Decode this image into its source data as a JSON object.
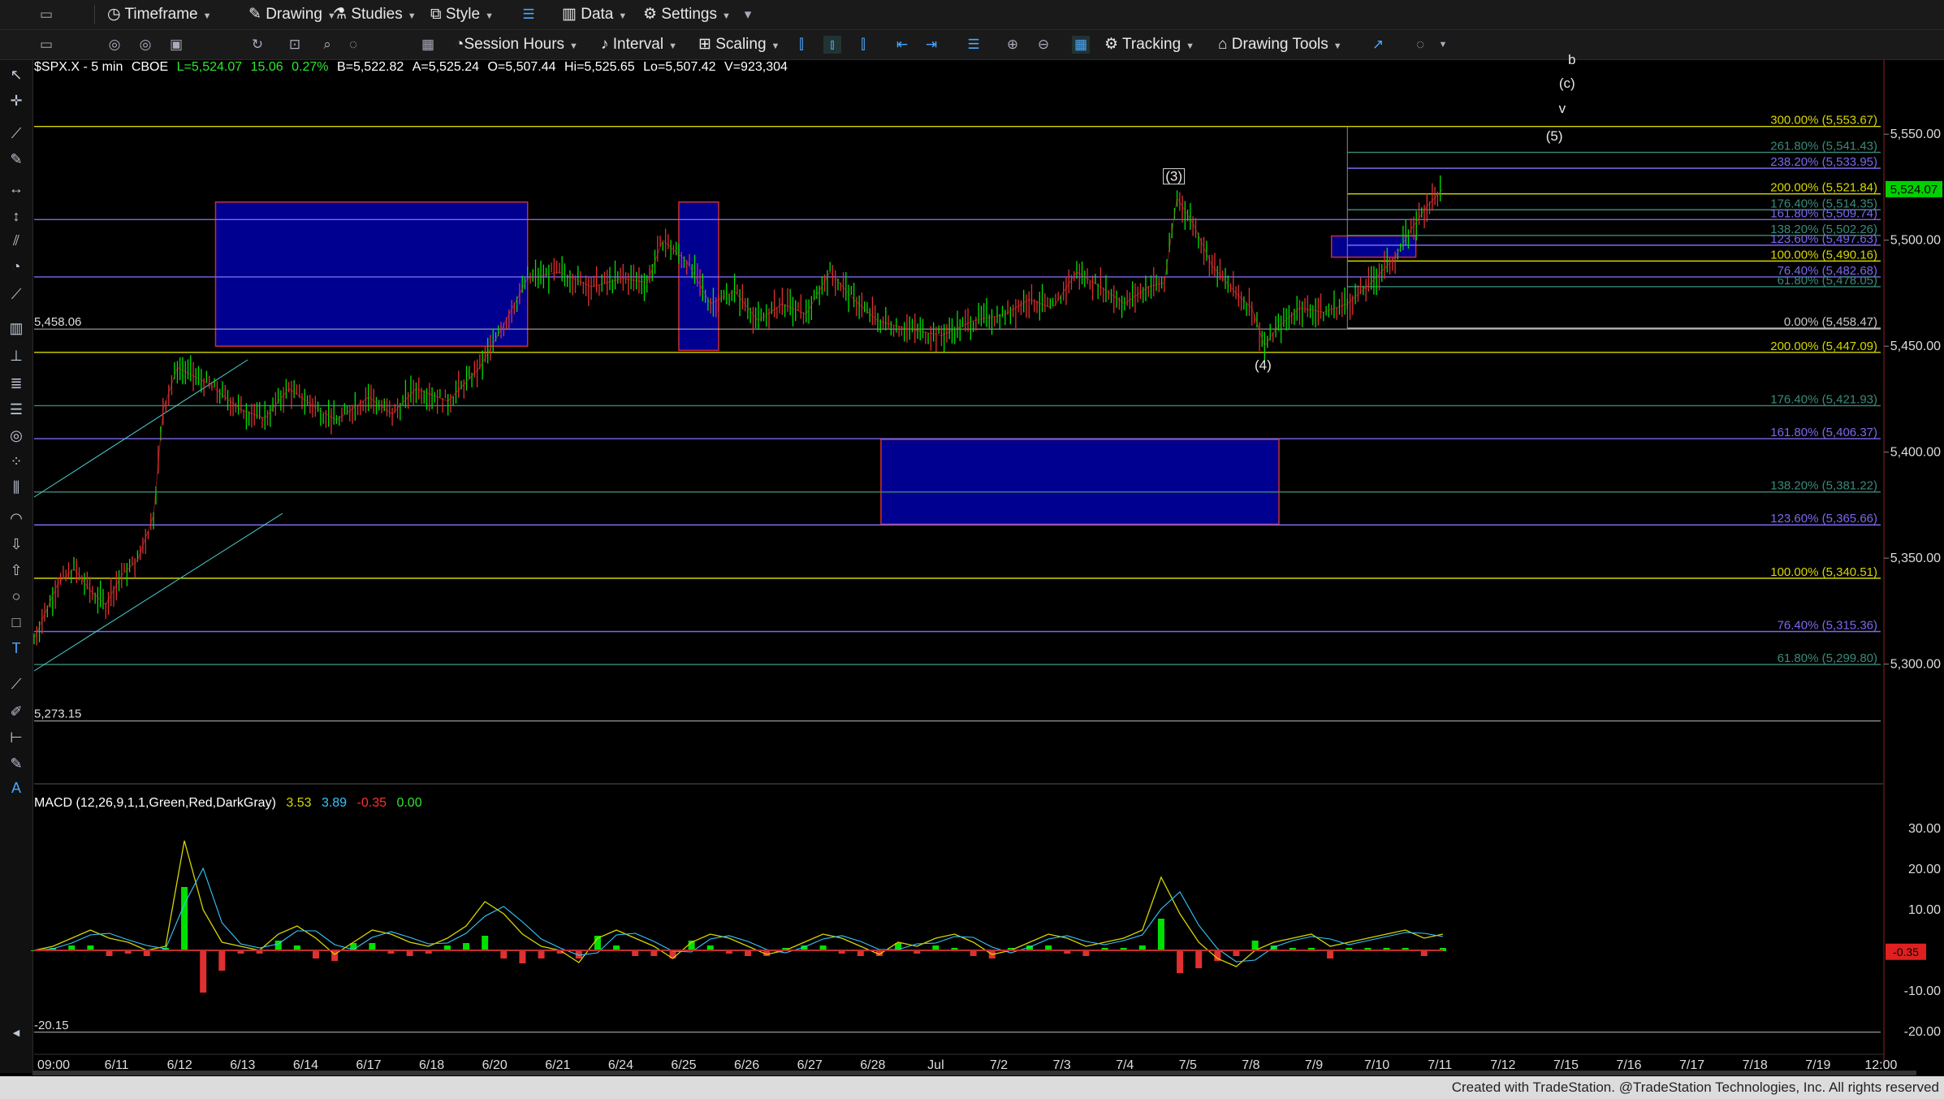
{
  "toolbar_top": {
    "items": [
      {
        "label": "Timeframe",
        "icon": "clock-icon"
      },
      {
        "label": "Drawing",
        "icon": "pencil-icon"
      },
      {
        "label": "Studies",
        "icon": "flask-icon"
      },
      {
        "label": "Style",
        "icon": "style-icon"
      },
      {
        "label": "Data",
        "icon": "bar-chart-icon"
      },
      {
        "label": "Settings",
        "icon": "gear-icon"
      }
    ]
  },
  "toolbar_second": {
    "items": [
      {
        "label": "Session Hours",
        "icon": "session-icon"
      },
      {
        "label": "Interval",
        "icon": "interval-icon"
      },
      {
        "label": "Scaling",
        "icon": "scaling-icon"
      },
      {
        "label": "Tracking",
        "icon": "tracking-icon"
      },
      {
        "label": "Drawing Tools",
        "icon": "drawing-tools-icon"
      }
    ]
  },
  "symbol_header": {
    "symbol": "$SPX.X - 5 min",
    "exchange": "CBOE",
    "last": "L=5,524.07",
    "change": "15.06",
    "change_pct": "0.27%",
    "bid": "B=5,522.82",
    "ask": "A=5,525.24",
    "open": "O=5,507.44",
    "high": "Hi=5,525.65",
    "low": "Lo=5,507.42",
    "volume": "V=923,304"
  },
  "macd_header": {
    "label": "MACD (12,26,9,1,1,Green,Red,DarkGray)",
    "v1": "3.53",
    "v2": "3.89",
    "v3": "-0.35",
    "v4": "0.00"
  },
  "footer_text": "Created with TradeStation. @TradeStation Technologies, Inc. All rights reserved",
  "colors": {
    "background": "#000000",
    "up_candle": "#00e000",
    "down_candle": "#e03030",
    "yellow_fib": "#d6d600",
    "purple_fib": "#6a5acd",
    "teal_fib": "#3a8a7a",
    "blue_box": "#000090",
    "price_tag": "#00d000",
    "macd_tag": "#e02020"
  },
  "chart_data": {
    "type": "line",
    "title": "$SPX.X - 5 min",
    "x_tick_labels": [
      "09:00",
      "6/11",
      "6/12",
      "6/13",
      "6/14",
      "6/17",
      "6/18",
      "6/20",
      "6/21",
      "6/24",
      "6/25",
      "6/26",
      "6/27",
      "6/28",
      "Jul",
      "7/2",
      "7/3",
      "7/4",
      "7/5",
      "7/8",
      "7/9",
      "7/10",
      "7/11",
      "7/12",
      "7/15",
      "7/16",
      "7/17",
      "7/18",
      "7/19",
      "12:00"
    ],
    "y_tick_labels": [
      "5,550.00",
      "5,500.00",
      "5,450.00",
      "5,400.00",
      "5,350.00",
      "5,300.00"
    ],
    "y_ticks": [
      5550,
      5500,
      5450,
      5400,
      5350,
      5300
    ],
    "ylim": [
      5255,
      5575
    ],
    "last_price": 5524.07,
    "last_price_label": "5,524.07",
    "left_labels": [
      {
        "text": "5,458.06",
        "value": 5458.06
      },
      {
        "text": "5,273.15",
        "value": 5273.15
      }
    ],
    "price_path": [
      {
        "t": 0,
        "p": 5312
      },
      {
        "t": 1.5,
        "p": 5338
      },
      {
        "t": 2.5,
        "p": 5345
      },
      {
        "t": 3.5,
        "p": 5335
      },
      {
        "t": 4.5,
        "p": 5328
      },
      {
        "t": 5.5,
        "p": 5342
      },
      {
        "t": 6.5,
        "p": 5349
      },
      {
        "t": 7.5,
        "p": 5370
      },
      {
        "t": 8.1,
        "p": 5420
      },
      {
        "t": 9,
        "p": 5440
      },
      {
        "t": 11,
        "p": 5432
      },
      {
        "t": 13,
        "p": 5420
      },
      {
        "t": 14.5,
        "p": 5416
      },
      {
        "t": 16,
        "p": 5430
      },
      {
        "t": 17.5,
        "p": 5422
      },
      {
        "t": 19,
        "p": 5415
      },
      {
        "t": 21,
        "p": 5426
      },
      {
        "t": 22.5,
        "p": 5418
      },
      {
        "t": 24,
        "p": 5430
      },
      {
        "t": 26,
        "p": 5424
      },
      {
        "t": 28,
        "p": 5440
      },
      {
        "t": 29.5,
        "p": 5460
      },
      {
        "t": 31,
        "p": 5482
      },
      {
        "t": 33,
        "p": 5485
      },
      {
        "t": 35,
        "p": 5478
      },
      {
        "t": 37,
        "p": 5482
      },
      {
        "t": 38.5,
        "p": 5480
      },
      {
        "t": 39.5,
        "p": 5500
      },
      {
        "t": 41,
        "p": 5490
      },
      {
        "t": 42.5,
        "p": 5470
      },
      {
        "t": 44,
        "p": 5476
      },
      {
        "t": 45.5,
        "p": 5462
      },
      {
        "t": 47,
        "p": 5470
      },
      {
        "t": 48.5,
        "p": 5465
      },
      {
        "t": 50,
        "p": 5485
      },
      {
        "t": 51.5,
        "p": 5472
      },
      {
        "t": 53,
        "p": 5462
      },
      {
        "t": 55,
        "p": 5458
      },
      {
        "t": 57,
        "p": 5455
      },
      {
        "t": 59,
        "p": 5462
      },
      {
        "t": 61,
        "p": 5465
      },
      {
        "t": 62.5,
        "p": 5472
      },
      {
        "t": 64,
        "p": 5468
      },
      {
        "t": 65.5,
        "p": 5485
      },
      {
        "t": 67,
        "p": 5478
      },
      {
        "t": 68.5,
        "p": 5470
      },
      {
        "t": 70,
        "p": 5478
      },
      {
        "t": 71,
        "p": 5480
      },
      {
        "t": 71.8,
        "p": 5520
      },
      {
        "t": 72.8,
        "p": 5508
      },
      {
        "t": 74,
        "p": 5488
      },
      {
        "t": 75.5,
        "p": 5475
      },
      {
        "t": 76.5,
        "p": 5468
      },
      {
        "t": 77.3,
        "p": 5450
      },
      {
        "t": 78,
        "p": 5458
      },
      {
        "t": 79.5,
        "p": 5468
      },
      {
        "t": 81,
        "p": 5466
      },
      {
        "t": 82.5,
        "p": 5470
      },
      {
        "t": 84,
        "p": 5480
      },
      {
        "t": 85.5,
        "p": 5492
      },
      {
        "t": 86.5,
        "p": 5505
      },
      {
        "t": 87.5,
        "p": 5516
      },
      {
        "t": 88.5,
        "p": 5524
      }
    ],
    "fib_levels": [
      {
        "label": "300.00% (5,553.67)",
        "value": 5553.67,
        "color": "#d6d600",
        "full": true
      },
      {
        "label": "261.80% (5,541.43)",
        "value": 5541.43,
        "color": "#3a8a7a",
        "full": false
      },
      {
        "label": "238.20% (5,533.95)",
        "value": 5533.95,
        "color": "#7b68ee",
        "full": false
      },
      {
        "label": "200.00% (5,521.84)",
        "value": 5521.84,
        "color": "#d6d600",
        "full": false
      },
      {
        "label": "176.40% (5,514.35)",
        "value": 5514.35,
        "color": "#3a8a7a",
        "full": false
      },
      {
        "label": "161.80% (5,509.74)",
        "value": 5509.74,
        "color": "#7b68ee",
        "full": true
      },
      {
        "label": "138.20% (5,502.26)",
        "value": 5502.26,
        "color": "#3a8a7a",
        "full": false
      },
      {
        "label": "123.60% (5,497.63)",
        "value": 5497.63,
        "color": "#7b68ee",
        "full": false
      },
      {
        "label": "100.00% (5,490.16)",
        "value": 5490.16,
        "color": "#d6d600",
        "full": false
      },
      {
        "label": "76.40% (5,482.68)",
        "value": 5482.68,
        "color": "#7b68ee",
        "full": true
      },
      {
        "label": "61.80% (5,478.05)",
        "value": 5478.05,
        "color": "#3a8a7a",
        "full": false
      },
      {
        "label": "0.00% (5,458.47)",
        "value": 5458.47,
        "color": "#c8c8c8",
        "full": false
      },
      {
        "label": "200.00% (5,447.09)",
        "value": 5447.09,
        "color": "#d6d600",
        "full": true
      },
      {
        "label": "176.40% (5,421.93)",
        "value": 5421.93,
        "color": "#3a8a7a",
        "full": true
      },
      {
        "label": "161.80% (5,406.37)",
        "value": 5406.37,
        "color": "#7b68ee",
        "full": true
      },
      {
        "label": "138.20% (5,381.22)",
        "value": 5381.22,
        "color": "#3a8a7a",
        "full": true
      },
      {
        "label": "123.60% (5,365.66)",
        "value": 5365.66,
        "color": "#7b68ee",
        "full": true
      },
      {
        "label": "100.00% (5,340.51)",
        "value": 5340.51,
        "color": "#d6d600",
        "full": true
      },
      {
        "label": "76.40% (5,315.36)",
        "value": 5315.36,
        "color": "#7b68ee",
        "full": true
      },
      {
        "label": "61.80% (5,299.80)",
        "value": 5299.8,
        "color": "#3a8a7a",
        "full": true
      }
    ],
    "boxes": [
      {
        "t0": 11.4,
        "t1": 31.0,
        "top": 5518,
        "bottom": 5450
      },
      {
        "t0": 40.5,
        "t1": 43.0,
        "top": 5518,
        "bottom": 5448
      },
      {
        "t0": 53.2,
        "t1": 78.2,
        "top": 5406,
        "bottom": 5366
      },
      {
        "t0": 81.5,
        "t1": 86.8,
        "top": 5502,
        "bottom": 5492
      }
    ],
    "wave_labels": [
      {
        "text": "(3)",
        "t": 71.6,
        "p": 5528
      },
      {
        "text": "(4)",
        "t": 77.2,
        "p": 5439
      },
      {
        "text": "(5)",
        "t": 95.5,
        "p": 5547
      },
      {
        "text": "v",
        "t": 96.0,
        "p": 5560
      },
      {
        "text": "(c)",
        "t": 96.3,
        "p": 5572
      },
      {
        "text": "b",
        "t": 96.6,
        "p": 5583
      }
    ],
    "macd": {
      "ylim": [
        -24,
        35
      ],
      "y_ticks": [
        30,
        20,
        10,
        -10,
        -20
      ],
      "y_tick_labels": [
        "30.00",
        "20.00",
        "10.00",
        "-10.00",
        "-20.00"
      ],
      "last_label": "-0.35",
      "lower_label": "-20.15",
      "lower_value": -20.15,
      "macd_line": [
        0,
        1,
        3,
        5,
        3,
        2,
        0,
        1,
        27,
        10,
        2,
        1,
        0,
        4,
        6,
        3,
        -1,
        2,
        5,
        4,
        2,
        1,
        3,
        6,
        12,
        9,
        4,
        1,
        0,
        -3,
        3,
        5,
        3,
        1,
        -2,
        2,
        4,
        3,
        1,
        -1,
        0,
        2,
        4,
        3,
        1,
        -1,
        2,
        1,
        3,
        4,
        2,
        -1,
        0,
        2,
        4,
        3,
        1,
        2,
        3,
        5,
        18,
        9,
        2,
        -2,
        -4,
        0,
        2,
        3,
        4,
        1,
        2,
        3,
        4,
        5,
        3,
        4
      ]
    }
  }
}
